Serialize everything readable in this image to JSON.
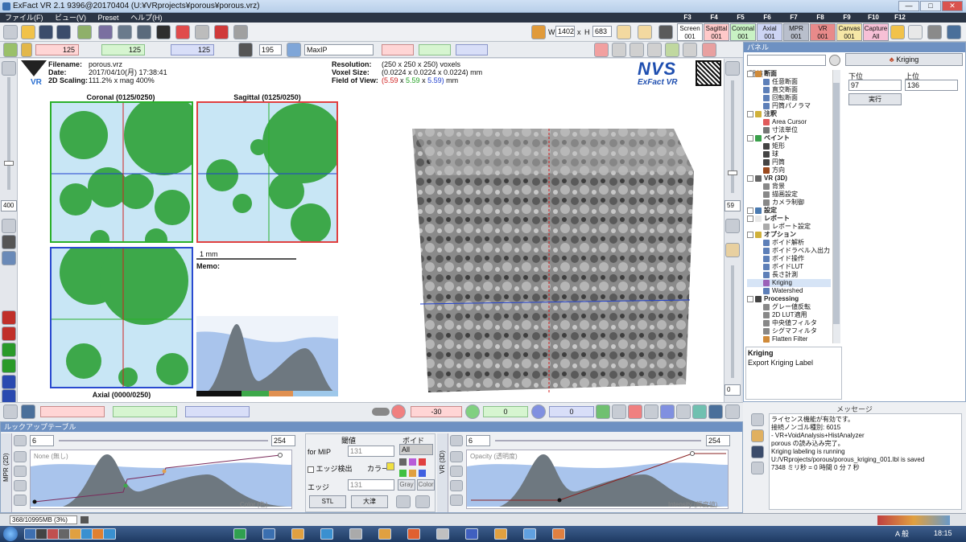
{
  "window": {
    "title": "ExFact VR 2.1 9396@20170404 (U:¥VRprojects¥porous¥porous.vrz)",
    "min": "—",
    "max": "□",
    "close": "✕"
  },
  "menu": [
    "ファイル(F)",
    "ビュー(V)",
    "Preset",
    "ヘルプ(H)"
  ],
  "fkeys": [
    "F3",
    "F4",
    "F5",
    "F6",
    "F7",
    "F8",
    "F9",
    "F10",
    "F12"
  ],
  "view_buttons": [
    {
      "label": "Screen",
      "sub": "001",
      "color": "#ffffff"
    },
    {
      "label": "Sagittal",
      "sub": "001",
      "color": "#ffc9c9"
    },
    {
      "label": "Coronal",
      "sub": "001",
      "color": "#c9f2c4"
    },
    {
      "label": "Axial",
      "sub": "001",
      "color": "#cdd4f4"
    },
    {
      "label": "MPR",
      "sub": "001",
      "color": "#b9bfcc"
    },
    {
      "label": "VR",
      "sub": "001",
      "color": "#e88a8a"
    },
    {
      "label": "Canvas",
      "sub": "001",
      "color": "#f6e7a6"
    },
    {
      "label": "Capture",
      "sub": "All",
      "color": "#f7c0d6"
    }
  ],
  "toolbar": {
    "w_label": "W",
    "w_value": "1402",
    "x_label": "x",
    "h_label": "H",
    "h_value": "683",
    "slab_value": "125",
    "thickness_value": "195",
    "render_mode": "MaxIP"
  },
  "info": {
    "filename_label": "Filename:",
    "filename": "porous.vrz",
    "date_label": "Date:",
    "date": "2017/04/10(月) 17:38:41",
    "scaling_label": "2D Scaling:",
    "scaling": "111.2% x mag 400%",
    "resolution_label": "Resolution:",
    "resolution": "(250 x 250 x 250) voxels",
    "voxel_label": "Voxel Size:",
    "voxel": "(0.0224 x 0.0224 x 0.0224) mm",
    "fov_label": "Field of View:",
    "fov_a": "(5.59",
    "fov_x1": " x ",
    "fov_b": "5.59",
    "fov_x2": " x ",
    "fov_c": "5.59)",
    "fov_unit": " mm",
    "logo_main": "NVS",
    "logo_sub": "ExFact VR",
    "vr_mark": "VR"
  },
  "slices": {
    "coronal": "Coronal (0125/0250)",
    "sagittal": "Sagittal (0125/0250)",
    "axial": "Axial (0000/0250)"
  },
  "scalebar": "1 mm",
  "memo": "Memo:",
  "left_zoom": "400",
  "right_zoom": "59",
  "right_zoom2": "0",
  "panel": {
    "title": "パネル",
    "kriging_label": "Kriging",
    "lower_label": "下位",
    "lower_value": "97",
    "upper_label": "上位",
    "upper_value": "136",
    "threshold_label": "閾値",
    "exec_label": "実行",
    "desc_title": "Kriging",
    "desc_body": "Export Kriging Label"
  },
  "tree": [
    {
      "cat": true,
      "label": "断面",
      "icon": "#d08b3a"
    },
    {
      "label": "任意断面",
      "icon": "#5d7fb8"
    },
    {
      "label": "直交断面",
      "icon": "#5d7fb8"
    },
    {
      "label": "回転断面",
      "icon": "#5d7fb8"
    },
    {
      "label": "円筒パノラマ",
      "icon": "#5d7fb8"
    },
    {
      "cat": true,
      "label": "注釈",
      "icon": "#d0b13a"
    },
    {
      "label": "Area Cursor",
      "icon": "#e05a5a"
    },
    {
      "label": "寸法単位",
      "icon": "#777777"
    },
    {
      "cat": true,
      "label": "ペイント",
      "icon": "#3aa04b"
    },
    {
      "label": "矩形",
      "icon": "#444444"
    },
    {
      "label": "球",
      "icon": "#444444"
    },
    {
      "label": "円筒",
      "icon": "#444444"
    },
    {
      "label": "方向",
      "icon": "#9b4a1f"
    },
    {
      "cat": true,
      "label": "VR (3D)",
      "icon": "#666666"
    },
    {
      "label": "背景",
      "icon": "#888888"
    },
    {
      "label": "描画設定",
      "icon": "#888888"
    },
    {
      "label": "カメラ制御",
      "icon": "#888888"
    },
    {
      "cat": true,
      "label": "設定",
      "icon": "#4a7ab0"
    },
    {
      "cat": true,
      "label": "レポート",
      "icon": "#e8e8e8"
    },
    {
      "label": "レポート設定",
      "icon": "#aaaaaa"
    },
    {
      "cat": true,
      "label": "オプション",
      "icon": "#d0b13a"
    },
    {
      "label": "ボイド解析",
      "icon": "#5d7fb8"
    },
    {
      "label": "ボイドラベル入出力",
      "icon": "#5d7fb8"
    },
    {
      "label": "ボイド操作",
      "icon": "#5d7fb8"
    },
    {
      "label": "ボイドLUT",
      "icon": "#5d7fb8"
    },
    {
      "label": "長さ計測",
      "icon": "#5d7fb8"
    },
    {
      "label": "Kriging",
      "icon": "#9b62b8",
      "selected": true
    },
    {
      "label": "Watershed",
      "icon": "#5d7fb8"
    },
    {
      "cat": true,
      "label": "Processing",
      "icon": "#444444"
    },
    {
      "label": "グレー値反転",
      "icon": "#888888"
    },
    {
      "label": "2D LUT適用",
      "icon": "#888888"
    },
    {
      "label": "中央値フィルタ",
      "icon": "#888888"
    },
    {
      "label": "シグマフィルタ",
      "icon": "#888888"
    },
    {
      "label": "Flatten Filter",
      "icon": "#d08b3a"
    }
  ],
  "bottom_bar": {
    "val_a": "-30",
    "val_b": "0"
  },
  "lut": {
    "title": "ルックアップテーブル",
    "mpr_tab": "MPR (2D)",
    "vr_tab": "VR (3D)",
    "min": "6",
    "max": "254",
    "mpr_hint": "None (無し)",
    "mpr_axis": "Color (色)",
    "threshold_title": "閾値",
    "void_title": "ボイド",
    "for_mip": "for MIP",
    "mip_value": "131",
    "all_label": "All",
    "edge_detect": "エッジ検出",
    "color_label": "カラー",
    "edge_label": "エッジ",
    "edge_value": "131",
    "gray_btn": "Gray",
    "color_btn": "Color",
    "stl_btn": "STL",
    "otsu_btn": "大津",
    "vr_min": "6",
    "vr_max": "254",
    "vr_hint": "Opacity (透明度)",
    "vr_axis": "Intensity (輝度値)"
  },
  "messages": {
    "title": "メッセージ",
    "lines": [
      "ライセンス機能が有効です。",
      "接続ノンゴル種別: 6015",
      "- VR+VoidAnalysis+HistAnalyzer",
      "porous の読み込み完了。",
      "Kriging labeling is running",
      "U:/VRprojects/porous/porous_kriging_001.lbl is saved",
      "7348 ミリ秒 = 0 時間 0 分 7 秒"
    ]
  },
  "status": {
    "memory": "368/10995MB (3%)"
  },
  "taskbar": {
    "time": "18:15",
    "ime": "A 般"
  }
}
